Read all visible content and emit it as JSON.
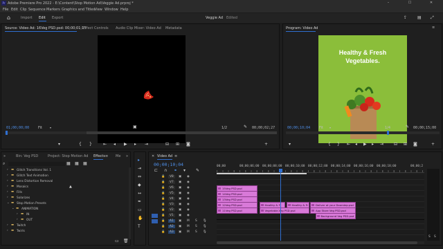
{
  "app": {
    "title": "Adobe Premiere Pro 2022 - E:\\Content\\Stop Motion Ad\\Veggie Ad.prproj *",
    "center_title": "Veggie Ad",
    "center_status": "Edited"
  },
  "menu": [
    "File",
    "Edit",
    "Clip",
    "Sequence",
    "Markers",
    "Graphics and Titles",
    "View",
    "Window",
    "Help"
  ],
  "workspace_tabs": [
    {
      "label": "Import",
      "active": false
    },
    {
      "label": "Edit",
      "active": true
    },
    {
      "label": "Export",
      "active": false
    }
  ],
  "source_panel": {
    "tabs": [
      "Source: Video Ad: 16Veg PSD.psd: 00;00;01;15",
      "Effect Controls",
      "Audio Clip Mixer: Video Ad",
      "Metadata"
    ],
    "timecode": "01;00;00;00",
    "fit": "Fit",
    "fraction": "1/2",
    "duration": "00;00;02;27"
  },
  "program_panel": {
    "tab": "Program: Video Ad",
    "poster_line1": "Healthy & Fresh",
    "poster_line2": "Vegetables.",
    "timecode": "00;00;10;04",
    "fit": "Fit",
    "fraction": "1/4",
    "duration": "00;00;15;00"
  },
  "project_panel": {
    "tabs": [
      "Bin: Veg PSD",
      "Project: Stop Motion Ad",
      "Effects",
      "Me"
    ],
    "tree": [
      {
        "label": "Glitch Transitions Vol. 1",
        "depth": 0
      },
      {
        "label": "Glitch Text Animation",
        "depth": 0
      },
      {
        "label": "Lens Distortion Removal",
        "depth": 0
      },
      {
        "label": "Mosaics",
        "depth": 0
      },
      {
        "label": "Fills",
        "depth": 0
      },
      {
        "label": "Solarizes",
        "depth": 0
      },
      {
        "label": "Stop Motion Presets",
        "depth": 0
      },
      {
        "label": "ANIMATION",
        "depth": 1
      },
      {
        "label": "IN",
        "depth": 2
      },
      {
        "label": "OUT",
        "depth": 2
      },
      {
        "label": "Twitch",
        "depth": 0
      },
      {
        "label": "Twirls",
        "depth": 0
      }
    ]
  },
  "timeline": {
    "tab": "Video Ad",
    "timecode": "00;00;10;04",
    "ruler": [
      "00;00",
      "00;00;06;00",
      "00;00;08;00",
      "00;00;10;00",
      "00;00;12;00",
      "00;00;14;00",
      "00;00;16;00",
      "00;00;18;00",
      "00;00;2"
    ],
    "video_tracks": [
      "V8",
      "V7",
      "V6",
      "V5",
      "V4",
      "V3",
      "V2",
      "V1"
    ],
    "audio_tracks": [
      "A1",
      "A2",
      "A3"
    ],
    "track_letters": {
      "mute": "M",
      "solo": "S"
    },
    "clips": [
      {
        "label": "15Veg PSD.psd",
        "row": 0,
        "start": 0,
        "len": 0.195
      },
      {
        "label": "14Veg PSD.psd",
        "row": 1,
        "start": 0,
        "len": 0.195
      },
      {
        "label": "13Veg PSD.psd",
        "row": 2,
        "start": 0,
        "len": 0.195
      },
      {
        "label": "12Veg PSD.psd",
        "row": 3,
        "start": 0,
        "len": 0.195
      },
      {
        "label": "Healthy & F",
        "row": 3,
        "start": 0.205,
        "len": 0.125
      },
      {
        "label": "Healthy & Fr",
        "row": 3,
        "start": 0.335,
        "len": 0.11
      },
      {
        "label": "Deliver at your Doorstep.psd",
        "row": 3,
        "start": 0.45,
        "len": 0.22
      },
      {
        "label": "11Veg PSD.psd",
        "row": 4,
        "start": 0,
        "len": 0.195
      },
      {
        "label": "Vegetable-Veg PSD.psd",
        "row": 4,
        "start": 0.205,
        "len": 0.24
      },
      {
        "label": "App Store Veg PSD.psd",
        "row": 4,
        "start": 0.45,
        "len": 0.22
      },
      {
        "label": "Background Veg PSD.psd",
        "row": 5,
        "start": 0.475,
        "len": 0.195
      }
    ],
    "playhead": 0.305
  },
  "colors": {
    "accent": "#2f6fd1",
    "clip": "#d879d8",
    "poster_bg": "#8bbe3a"
  }
}
